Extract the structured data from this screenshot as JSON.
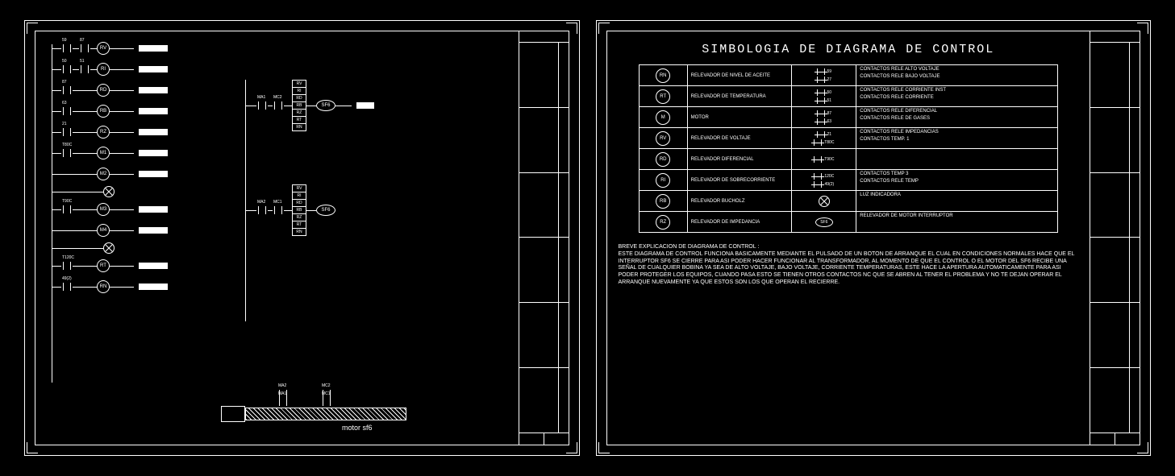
{
  "left": {
    "rungs": [
      {
        "c1": "59",
        "c2": "87",
        "coil": "RV"
      },
      {
        "c1": "50",
        "c2": "51",
        "coil": "RI"
      },
      {
        "c1": "87",
        "c2": "",
        "coil": "RD"
      },
      {
        "c1": "63",
        "c2": "",
        "coil": "RB"
      },
      {
        "c1": "21",
        "c2": "",
        "coil": "RZ"
      },
      {
        "c1": "T80C",
        "c2": "",
        "coil": "M1"
      },
      {
        "c1": "",
        "c2": "",
        "coil": "M2",
        "lamp": true
      },
      {
        "c1": "T90C",
        "c2": "",
        "coil": "M3"
      },
      {
        "c1": "",
        "c2": "",
        "coil": "M4",
        "lamp": true
      },
      {
        "c1": "T120C",
        "c2": "",
        "coil": "RT"
      },
      {
        "c1": "49(2)",
        "c2": "",
        "coil": "RN"
      }
    ],
    "mid": {
      "ma1": "MA1",
      "mc2": "MC2",
      "ma2": "MA2",
      "mc1": "MC1",
      "stack1": [
        "RV",
        "RI",
        "RD",
        "RB",
        "RZ",
        "RT",
        "RN"
      ],
      "sf6a": "SF6",
      "stack2": [
        "RV",
        "RI",
        "RD",
        "RB",
        "RZ",
        "RT",
        "RN"
      ],
      "sf6b": "SF6",
      "bottom": {
        "ma1": "MA1",
        "ma2": "MA2",
        "mc1": "MC1",
        "mc2": "MC2"
      }
    },
    "motor_label": "motor sf6"
  },
  "right": {
    "title": "SIMBOLOGIA DE DIAGRAMA DE CONTROL",
    "legend": [
      {
        "sym": "RN",
        "desc": "RELEVADOR DE NIVEL DE ACEITE",
        "c": [
          {
            "n": "59",
            "t": "CONTACTOS RELE ALTO VOLTAJE"
          },
          {
            "n": "27",
            "t": "CONTACTOS RELE BAJO VOLTAJE"
          }
        ]
      },
      {
        "sym": "RT",
        "desc": "RELEVADOR DE TEMPERATURA",
        "c": [
          {
            "n": "50",
            "t": "CONTACTOS RELE CORRIENTE INST"
          },
          {
            "n": "51",
            "t": "CONTACTOS RELE CORRIENTE"
          }
        ]
      },
      {
        "sym": "M",
        "desc": "MOTOR",
        "c": [
          {
            "n": "87",
            "t": "CONTACTOS RELE DIFERENCIAL"
          },
          {
            "n": "63",
            "t": "CONTACTOS RELE DE GASES"
          }
        ]
      },
      {
        "sym": "RV",
        "desc": "RELEVADOR DE VOLTAJE",
        "c": [
          {
            "n": "21",
            "t": "CONTACTOS RELE IMPEDANCIAS"
          },
          {
            "n": "T80C",
            "t": "CONTACTOS TEMP. 1"
          }
        ]
      },
      {
        "sym": "RD",
        "desc": "RELEVADOR DIFERENCIAL",
        "c": [
          {
            "n": "T90C",
            "t": ""
          }
        ]
      },
      {
        "sym": "RI",
        "desc": "RELEVADOR DE SOBRECORRIENTE",
        "c": [
          {
            "n": "120C",
            "t": "CONTACTOS TEMP 3"
          },
          {
            "n": "49(2)",
            "t": "CONTACTOS RELE TEMP"
          }
        ]
      },
      {
        "sym": "RB",
        "desc": "RELEVADOR BUCHOLZ",
        "extra": "lamp",
        "c": [
          {
            "n": "",
            "t": "LUZ INDICADORA"
          }
        ]
      },
      {
        "sym": "RZ",
        "desc": "RELEVADOR DE IMPEDANCIA",
        "extra": "sf6",
        "c": [
          {
            "n": "SF6",
            "t": "RELEVADOR DE MOTOR INTERRUPTOR"
          }
        ]
      }
    ],
    "explain_title": "BREVE EXPLICACION DE DIAGRAMA DE CONTROL :",
    "explain_body": "ESTE DIAGRAMA DE CONTROL FUNCIONA BASICAMENTE MEDIANTE EL PULSADO DE UN BOTON DE ARRANQUE EL CUAL EN CONDICIONES NORMALES HACE QUE EL INTERRUPTOR SF6 SE CIERRE PARA ASI PODER HACER FUNCIONAR AL TRANSFORMADOR, AL MOMENTO DE QUE EL CONTROL O EL MOTOR DEL SF6 RECIBE UNA SEÑAL DE CUALQUIER BOBINA YA SEA DE ALTO VOLTAJE, BAJO VOLTAJE, CORRIENTE TEMPERATURAS, ESTE HACE LA APERTURA AUTOMATICAMENTE PARA ASI PODER PROTEGER LOS EQUIPOS, CUANDO PASA ESTO SE TIENEN OTROS CONTACTOS NC QUE SE ABREN AL TENER EL PROBLEMA Y NO TE DEJAN OPERAR EL ARRANQUE NUEVAMENTE YA QUE ESTOS SON LOS QUE OPERAN EL RECIERRE."
  }
}
